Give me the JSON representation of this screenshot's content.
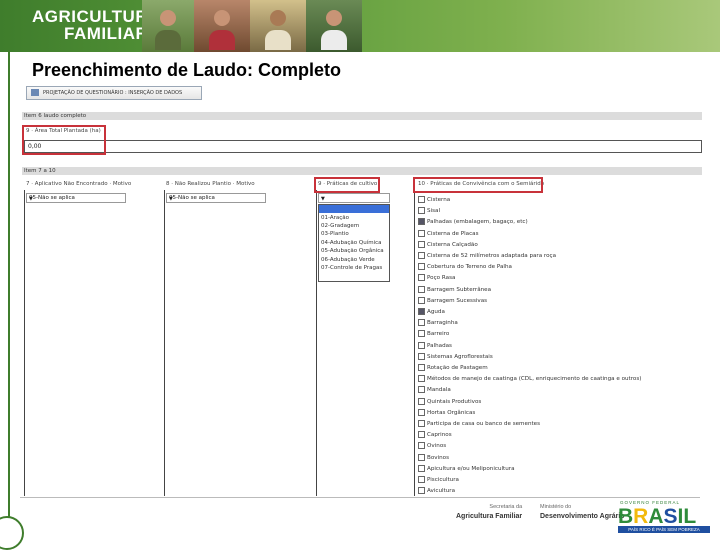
{
  "banner": {
    "logo_line1": "AGRICULTURA",
    "logo_line2": "FAMILIAR",
    "brand_color": "#3f7d2c"
  },
  "slide": {
    "title": "Preenchimento de Laudo: Completo"
  },
  "form": {
    "tab_label": "PROJETAÇÃO DE QUESTIONÁRIO : INSERÇÃO DE DADOS",
    "section1_title": "Item 6 laudo completo",
    "field9_label": "9 · Área Total Plantada (ha)",
    "field9_value": "0,00",
    "section2_title": "Item 7 a 10",
    "col7_label": "7 · Aplicativo Não Encontrado · Motivo",
    "col7_value": "05-Não se aplica",
    "col8_label": "8 · Não Realizou Plantio · Motivo",
    "col8_value": "05-Não se aplica",
    "col9_label": "9 · Práticas de cultivo",
    "col9_value": "-",
    "col9_options": [
      "01-Aração",
      "02-Gradagem",
      "03-Plantio",
      "04-Adubação Química",
      "05-Adubação Orgânica",
      "06-Adubação Verde",
      "07-Controle de Pragas"
    ],
    "col10_label": "10 · Práticas de Convivência com o Semiárido",
    "col10_items": [
      {
        "label": "Cisterna",
        "checked": false
      },
      {
        "label": "Sisal",
        "checked": false
      },
      {
        "label": "Palhadas (embalagem, bagaço, etc)",
        "checked": true
      },
      {
        "label": "Cisterna de Placas",
        "checked": false
      },
      {
        "label": "Cisterna Calçadão",
        "checked": false
      },
      {
        "label": "Cisterna de 52 milímetros adaptada para roça",
        "checked": false
      },
      {
        "label": "Cobertura do Terreno de Palha",
        "checked": false
      },
      {
        "label": "Poço Rasa",
        "checked": false
      },
      {
        "label": "Barragem Subterrânea",
        "checked": false
      },
      {
        "label": "Barragem Sucessivas",
        "checked": false
      },
      {
        "label": "Aguda",
        "checked": true
      },
      {
        "label": "Barraginha",
        "checked": false
      },
      {
        "label": "Barreiro",
        "checked": false
      },
      {
        "label": "Palhadas",
        "checked": false
      },
      {
        "label": "Sistemas Agroflorestais",
        "checked": false
      },
      {
        "label": "Rotação de Pastagem",
        "checked": false
      },
      {
        "label": "Métodos de manejo de caatinga (CDL, enriquecimento de caatinga e outros)",
        "checked": false
      },
      {
        "label": "Mandala",
        "checked": false
      },
      {
        "label": "Quintais Produtivos",
        "checked": false
      },
      {
        "label": "Hortas Orgânicas",
        "checked": false
      },
      {
        "label": "Participa de casa ou banco de sementes",
        "checked": false
      },
      {
        "label": "Caprinos",
        "checked": false
      },
      {
        "label": "Ovinos",
        "checked": false
      },
      {
        "label": "Bovinos",
        "checked": false
      },
      {
        "label": "Apicultura e/ou Meliponicultura",
        "checked": false
      },
      {
        "label": "Piscicultura",
        "checked": false
      },
      {
        "label": "Avicultura",
        "checked": false
      }
    ],
    "highlight_color": "#c8323a"
  },
  "footer": {
    "logo1_line1": "Secretaria da",
    "logo1_line2": "Agricultura Familiar",
    "logo2_line1": "Ministério do",
    "logo2_line2": "Desenvolvimento Agrário",
    "brasil_top": "GOVERNO FEDERAL",
    "brasil_word": "BRASIL",
    "brasil_slogan": "PAÍS RICO É PAÍS SEM POBREZA"
  }
}
